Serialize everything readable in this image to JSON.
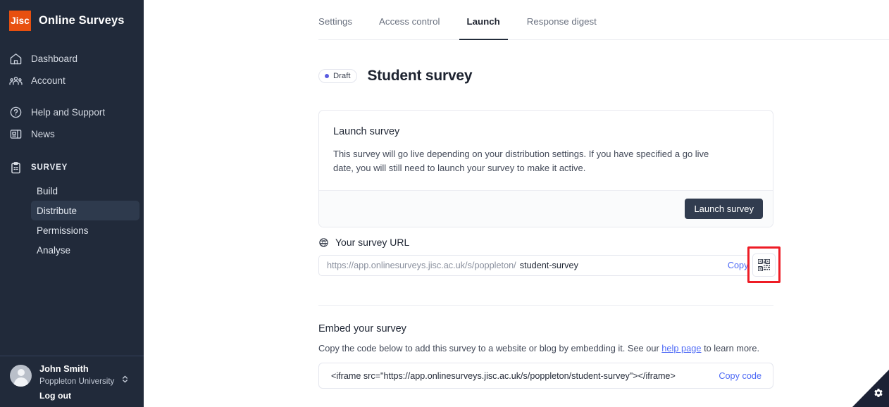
{
  "brand": {
    "logo_text": "Jisc",
    "title": "Online Surveys"
  },
  "sidebar": {
    "nav": [
      {
        "label": "Dashboard",
        "icon": "home-icon"
      },
      {
        "label": "Account",
        "icon": "users-icon"
      },
      {
        "label": "Help and Support",
        "icon": "question-circle-icon"
      },
      {
        "label": "News",
        "icon": "newspaper-icon"
      }
    ],
    "section": {
      "label": "SURVEY",
      "icon": "clipboard-icon"
    },
    "sub_items": [
      {
        "label": "Build",
        "active": false
      },
      {
        "label": "Distribute",
        "active": true
      },
      {
        "label": "Permissions",
        "active": false
      },
      {
        "label": "Analyse",
        "active": false
      }
    ],
    "user": {
      "name": "John Smith",
      "organisation": "Poppleton University",
      "logout_label": "Log out",
      "switcher_icon": "chevron-up-down-icon",
      "avatar_icon": "avatar-icon"
    }
  },
  "tabs": [
    {
      "label": "Settings",
      "active": false
    },
    {
      "label": "Access control",
      "active": false
    },
    {
      "label": "Launch",
      "active": true
    },
    {
      "label": "Response digest",
      "active": false
    }
  ],
  "header": {
    "status_badge": "Draft",
    "status_color": "#5a5ce0",
    "title": "Student survey"
  },
  "launch_card": {
    "title": "Launch survey",
    "description": "This survey will go live depending on your distribution settings. If you have specified a go live date, you will still need to launch your survey to make it active.",
    "button_label": "Launch survey"
  },
  "survey_url": {
    "section_label": "Your survey URL",
    "section_icon": "globe-icon",
    "prefix": "https://app.onlinesurveys.jisc.ac.uk/s/poppleton/",
    "slug": "student-survey",
    "copy_label": "Copy link",
    "qr_button_icon": "qr-code-icon",
    "highlight_color": "#ee1c25"
  },
  "embed": {
    "title": "Embed your survey",
    "description_before": "Copy the code below to add this survey to a website or blog by embedding it. See our ",
    "link_label": "help page",
    "description_after": " to learn more.",
    "code": "<iframe src=\"https://app.onlinesurveys.jisc.ac.uk/s/poppleton/student-survey\"></iframe>",
    "copy_label": "Copy code"
  },
  "corner_widget": {
    "icon": "gear-icon"
  }
}
